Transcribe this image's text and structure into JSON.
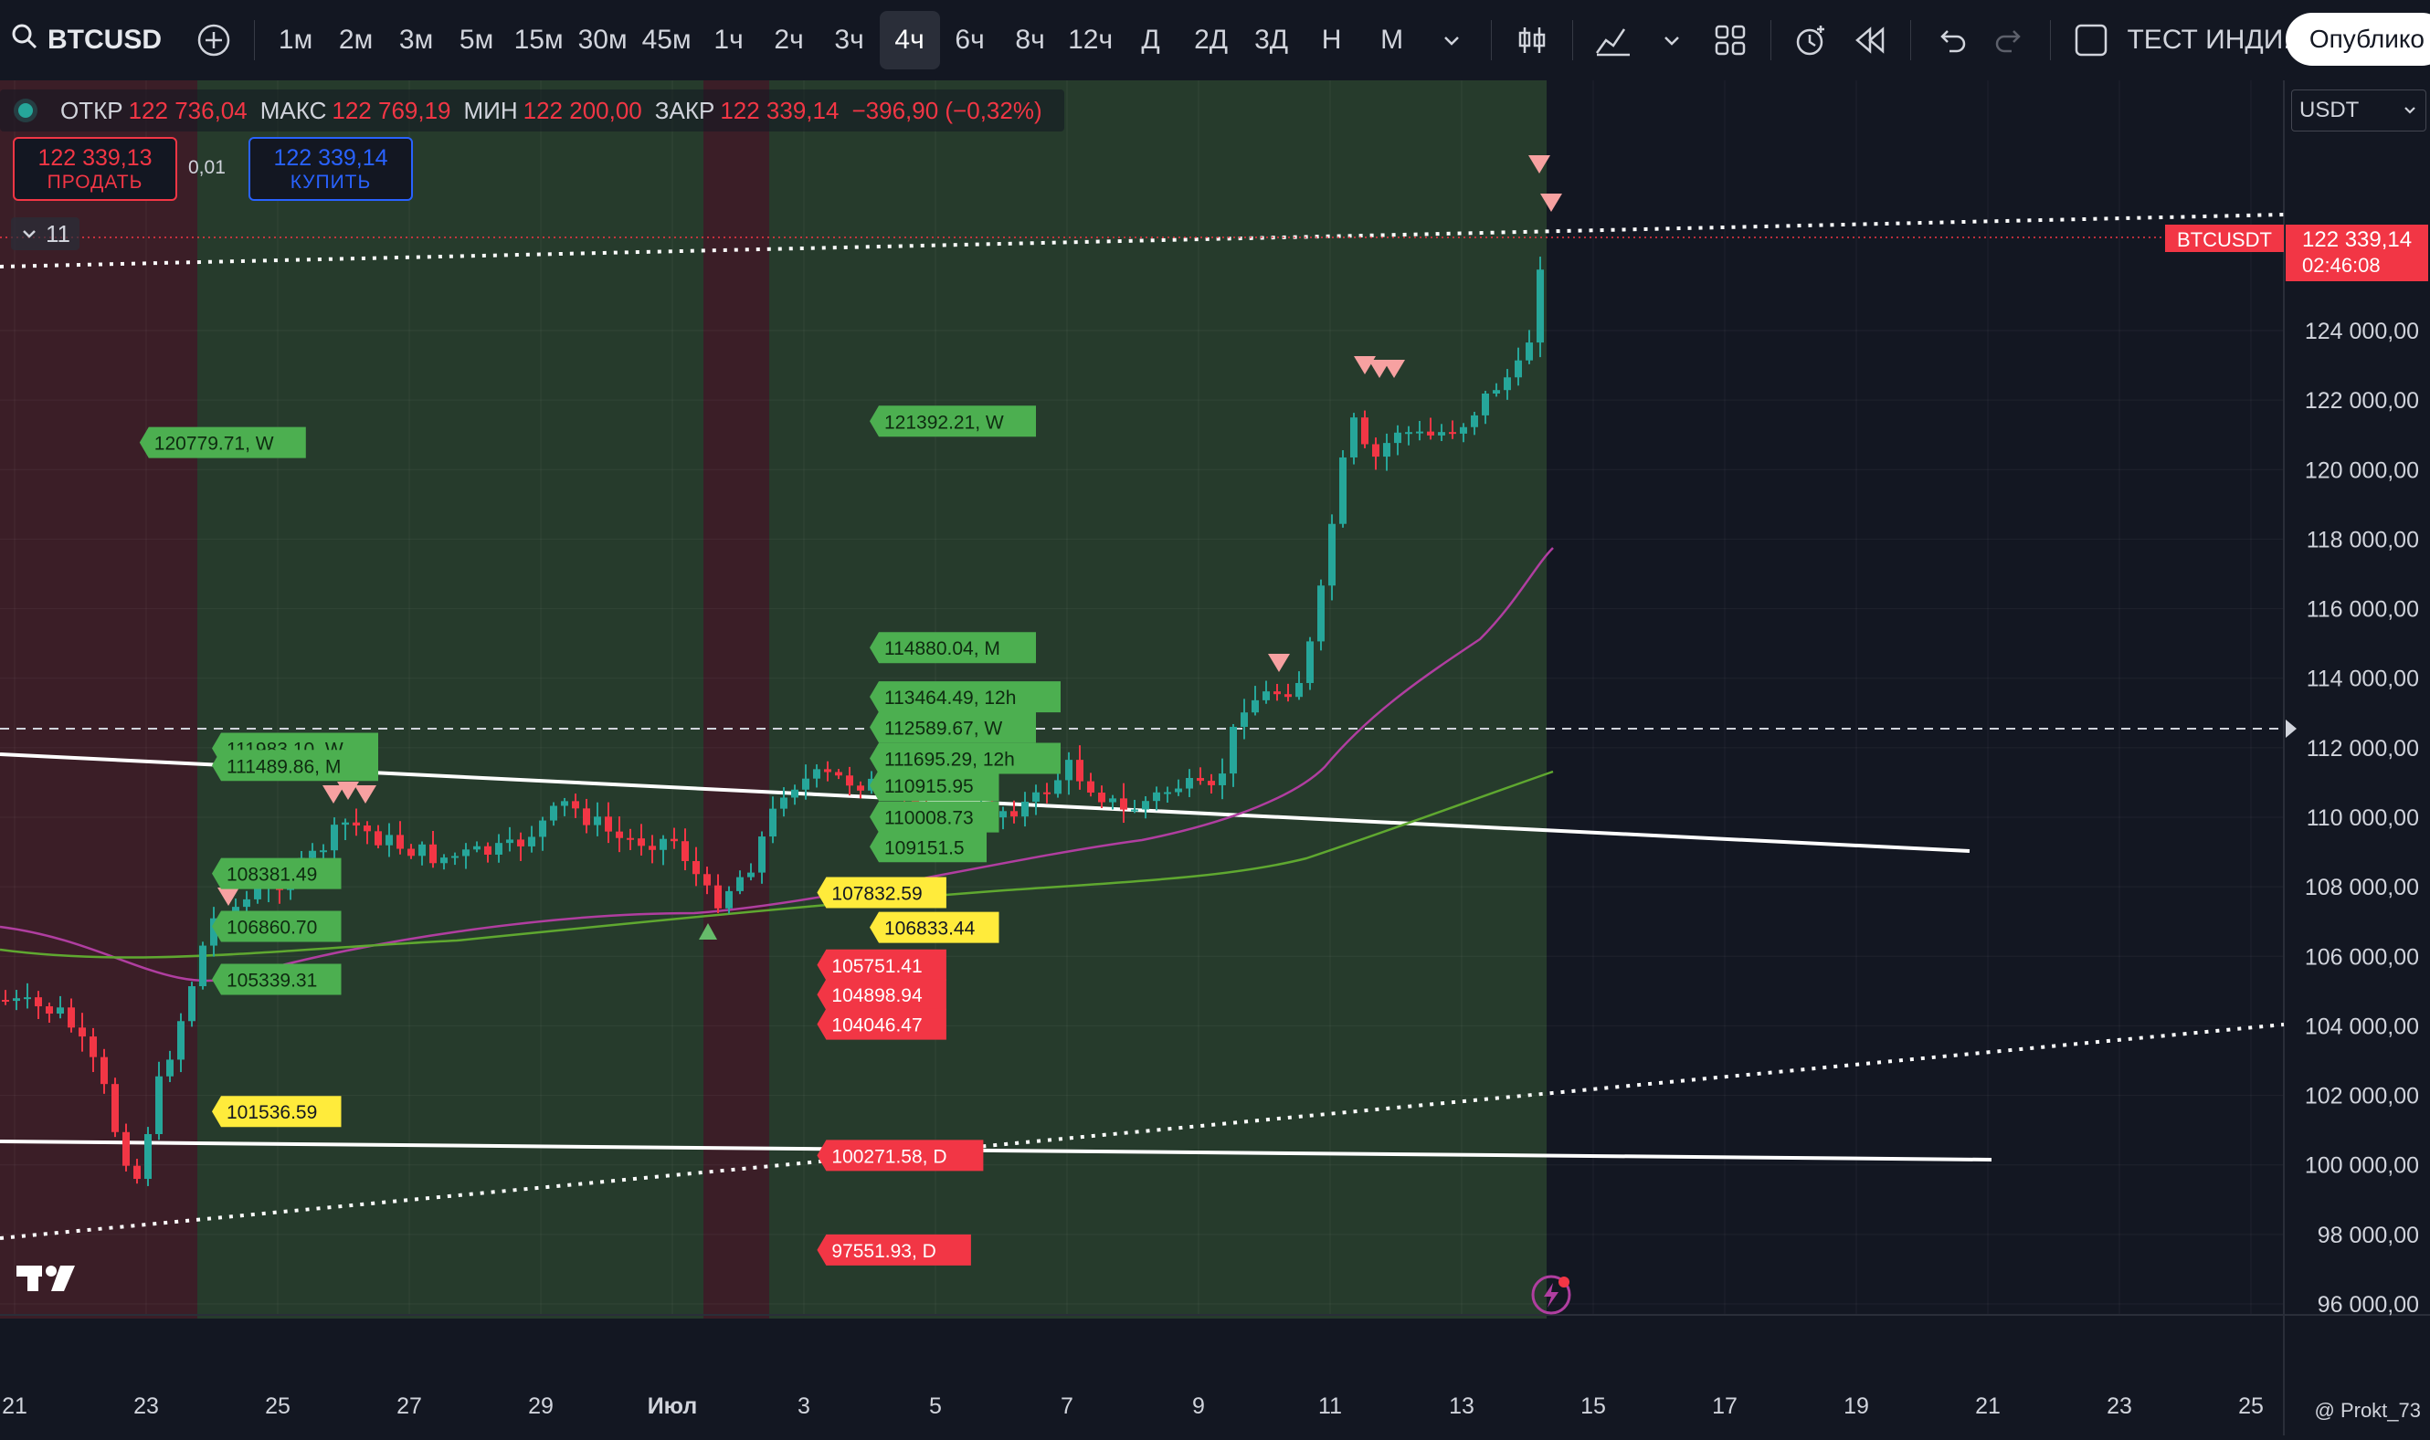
{
  "toolbar": {
    "symbol": "BTCUSD",
    "intervals": [
      "1м",
      "2м",
      "3м",
      "5м",
      "15м",
      "30м",
      "45м",
      "1ч",
      "2ч",
      "3ч",
      "4ч",
      "6ч",
      "8ч",
      "12ч",
      "Д",
      "2Д",
      "3Д",
      "Н",
      "М"
    ],
    "active_interval": "4ч",
    "indicator_name": "ТЕСТ ИНДИ...",
    "publish_label": "Опублико"
  },
  "legend": {
    "open_label": "ОТКР",
    "open": "122 736,04",
    "high_label": "МАКС",
    "high": "122 769,19",
    "low_label": "МИН",
    "low": "122 200,00",
    "close_label": "ЗАКР",
    "close": "122 339,14",
    "change": "−396,90 (−0,32%)"
  },
  "trade": {
    "sell_price": "122 339,13",
    "sell_label": "ПРОДАТЬ",
    "buy_price": "122 339,14",
    "buy_label": "КУПИТЬ",
    "spread": "0,01"
  },
  "collapse_count": "11",
  "currency": "USDT",
  "price_scale": [
    "124 000,00",
    "122 000,00",
    "120 000,00",
    "118 000,00",
    "116 000,00",
    "114 000,00",
    "112 000,00",
    "110 000,00",
    "108 000,00",
    "106 000,00",
    "104 000,00",
    "102 000,00",
    "100 000,00",
    "98 000,00",
    "96 000,00"
  ],
  "price_badge": {
    "symbol": "BTCUSDT",
    "price": "122 339,14",
    "countdown": "02:46:08"
  },
  "time_axis": [
    "21",
    "23",
    "25",
    "27",
    "29",
    "Июл",
    "3",
    "5",
    "7",
    "9",
    "11",
    "13",
    "15",
    "17",
    "19",
    "21",
    "23",
    "25"
  ],
  "labels": [
    {
      "text": "120779.71, W",
      "color": "#4caf50",
      "date_index": 1.9,
      "price": 120780
    },
    {
      "text": "121392.21, W",
      "color": "#4caf50",
      "date_index": 13.0,
      "price": 121392
    },
    {
      "text": "114880.04, M",
      "color": "#4caf50",
      "date_index": 13.0,
      "price": 114880
    },
    {
      "text": "113464.49, 12h",
      "color": "#4caf50",
      "date_index": 13.0,
      "price": 113464
    },
    {
      "text": "112589.67, W",
      "color": "#4caf50",
      "date_index": 13.0,
      "price": 112590
    },
    {
      "text": "111695.29, 12h",
      "color": "#4caf50",
      "date_index": 13.0,
      "price": 111695
    },
    {
      "text": "110915.95",
      "color": "#4caf50",
      "date_index": 13.0,
      "price": 110916
    },
    {
      "text": "110008.73",
      "color": "#4caf50",
      "date_index": 13.0,
      "price": 110009
    },
    {
      "text": "109151.5",
      "color": "#4caf50",
      "date_index": 13.0,
      "price": 109152
    },
    {
      "text": "111983.10, W",
      "color": "#4caf50",
      "date_index": 3.0,
      "price": 111983
    },
    {
      "text": "111489.86, M",
      "color": "#4caf50",
      "date_index": 3.0,
      "price": 111490
    },
    {
      "text": "108381.49",
      "color": "#4caf50",
      "date_index": 3.0,
      "price": 108381
    },
    {
      "text": "106860.70",
      "color": "#4caf50",
      "date_index": 3.0,
      "price": 106861
    },
    {
      "text": "105339.31",
      "color": "#4caf50",
      "date_index": 3.0,
      "price": 105339
    },
    {
      "text": "101536.59",
      "color": "#ffeb3b",
      "date_index": 3.0,
      "price": 101537
    },
    {
      "text": "107832.59",
      "color": "#ffeb3b",
      "date_index": 12.2,
      "price": 107833
    },
    {
      "text": "106833.44",
      "color": "#ffeb3b",
      "date_index": 13.0,
      "price": 106833
    },
    {
      "text": "105751.41",
      "color": "#f23645",
      "date_index": 12.2,
      "price": 105751
    },
    {
      "text": "104898.94",
      "color": "#f23645",
      "date_index": 12.2,
      "price": 104899
    },
    {
      "text": "104046.47",
      "color": "#f23645",
      "date_index": 12.2,
      "price": 104046
    },
    {
      "text": "100271.58, D",
      "color": "#f23645",
      "date_index": 12.2,
      "price": 100272
    },
    {
      "text": "97551.93, D",
      "color": "#f23645",
      "date_index": 12.2,
      "price": 97552
    }
  ],
  "watermark": "@ Prokt_73"
}
